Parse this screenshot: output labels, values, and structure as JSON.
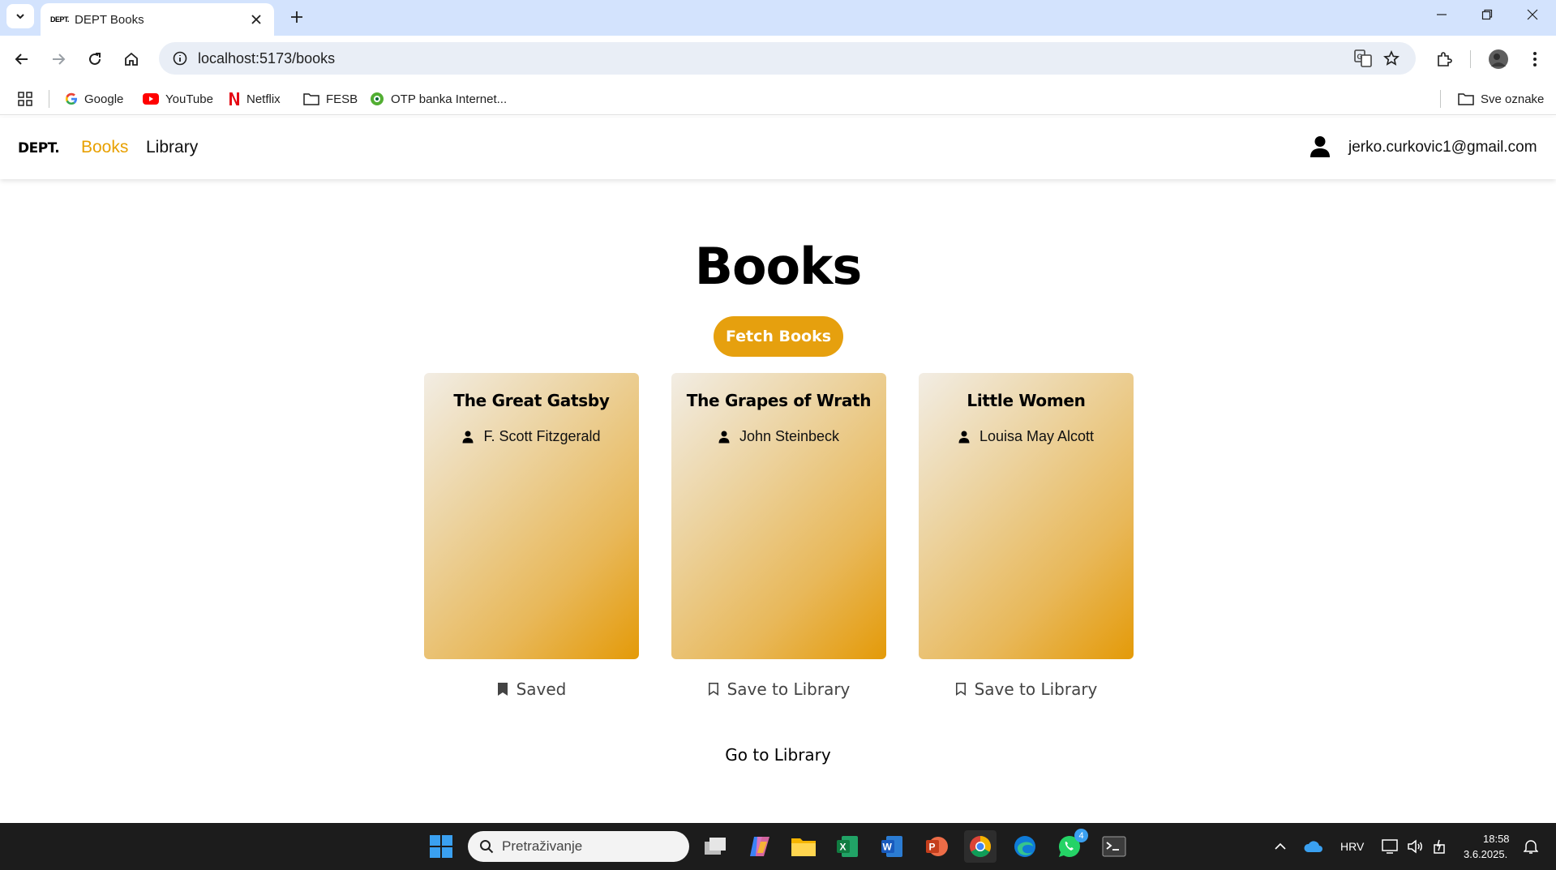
{
  "browser": {
    "tab_title": "DEPT Books",
    "tab_favicon_text": "DEPT.",
    "url": "localhost:5173/books",
    "bookmarks": [
      {
        "label": "Google",
        "icon": "google-icon"
      },
      {
        "label": "YouTube",
        "icon": "youtube-icon"
      },
      {
        "label": "Netflix",
        "icon": "netflix-icon"
      },
      {
        "label": "FESB",
        "icon": "folder-icon"
      },
      {
        "label": "OTP banka Internet...",
        "icon": "otp-icon"
      }
    ],
    "all_bookmarks_label": "Sve oznake"
  },
  "header": {
    "logo": "DEPT.",
    "nav": [
      {
        "label": "Books",
        "active": true
      },
      {
        "label": "Library",
        "active": false
      }
    ],
    "user_email": "jerko.curkovic1@gmail.com"
  },
  "main": {
    "title": "Books",
    "fetch_button": "Fetch Books",
    "books": [
      {
        "title": "The Great Gatsby",
        "author": "F. Scott Fitzgerald",
        "action": "Saved",
        "saved": true
      },
      {
        "title": "The Grapes of Wrath",
        "author": "John Steinbeck",
        "action": "Save to Library",
        "saved": false
      },
      {
        "title": "Little Women",
        "author": "Louisa May Alcott",
        "action": "Save to Library",
        "saved": false
      }
    ],
    "goto_library": "Go to Library"
  },
  "taskbar": {
    "search_placeholder": "Pretraživanje",
    "whatsapp_badge": "4",
    "language": "HRV",
    "time": "18:58",
    "date": "3.6.2025."
  },
  "colors": {
    "accent": "#e6a00e",
    "tabstrip": "#d3e3fd",
    "taskbar": "#1c1c1c"
  }
}
